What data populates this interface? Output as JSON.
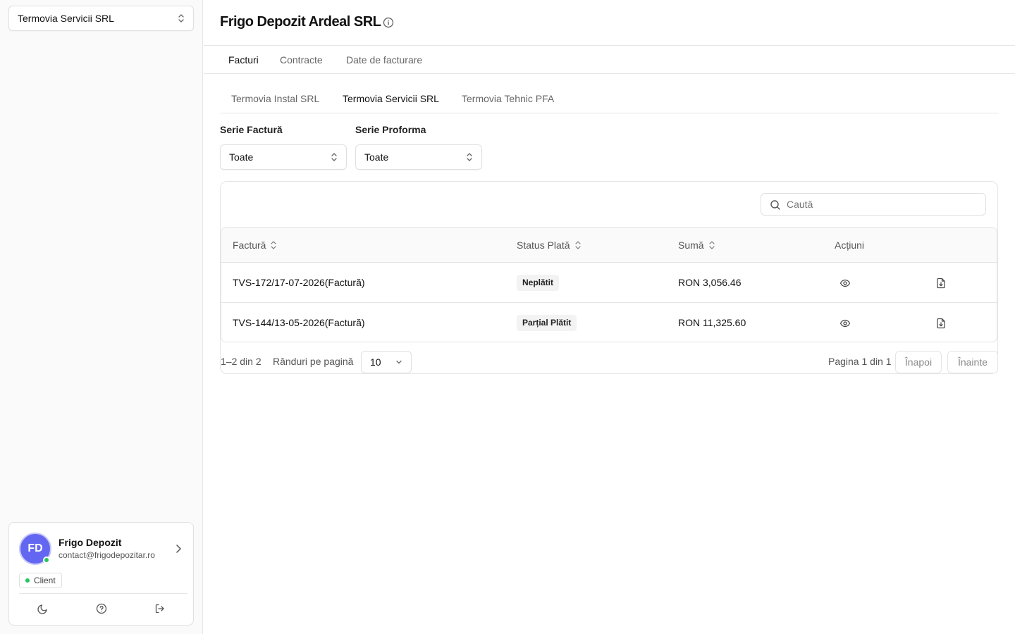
{
  "sidebar": {
    "org_select": {
      "value": "Termovia Servicii SRL",
      "icon": "chevron-up-down-icon"
    },
    "user": {
      "initials": "FD",
      "name": "Frigo Depozit",
      "email": "contact@frigodepozitar.ro",
      "role": "Client",
      "status_color": "#22c55e",
      "avatar_color": "#6366f1"
    },
    "actions": [
      "moon-icon",
      "help-icon",
      "logout-icon"
    ]
  },
  "header": {
    "title": "Frigo Depozit Ardeal SRL",
    "icon": "info-icon"
  },
  "tabs": [
    {
      "label": "Facturi",
      "active": true
    },
    {
      "label": "Contracte",
      "active": false
    },
    {
      "label": "Date de facturare",
      "active": false
    }
  ],
  "subtabs": [
    {
      "label": "Termovia Instal SRL",
      "active": false
    },
    {
      "label": "Termovia Servicii SRL",
      "active": true
    },
    {
      "label": "Termovia Tehnic PFA",
      "active": false
    }
  ],
  "filters": {
    "invoice_series": {
      "label": "Serie Factură",
      "value": "Toate"
    },
    "proforma_series": {
      "label": "Serie Proforma",
      "value": "Toate"
    }
  },
  "search": {
    "placeholder": "Caută"
  },
  "table": {
    "columns": [
      "Factură",
      "Status Plată",
      "Sumă",
      "Acțiuni"
    ],
    "rows": [
      {
        "invoice": "TVS-172/17-07-2026(Factură)",
        "status": "Neplătit",
        "amount": "RON 3,056.46"
      },
      {
        "invoice": "TVS-144/13-05-2026(Factură)",
        "status": "Parțial Plătit",
        "amount": "RON 11,325.60"
      }
    ]
  },
  "pagination": {
    "range": "1–2 din 2",
    "rows_label": "Rânduri pe pagină",
    "rows_value": "10",
    "page_info": "Pagina 1 din 1",
    "prev": "Înapoi",
    "next": "Înainte"
  }
}
